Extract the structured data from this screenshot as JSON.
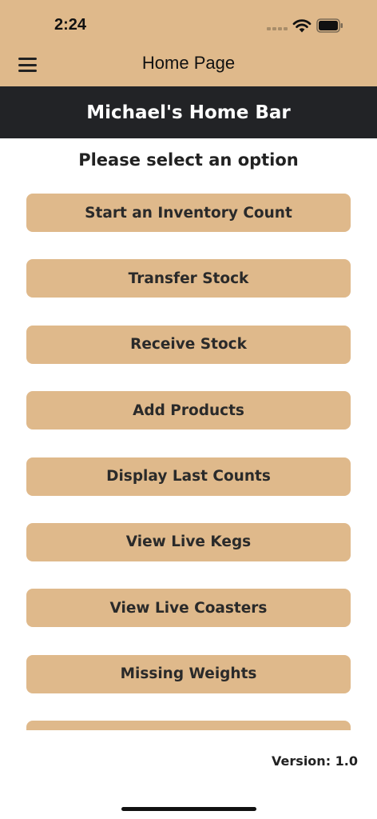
{
  "status_bar": {
    "time": "2:24",
    "icons": [
      "cellular-signal-icon",
      "wifi-icon",
      "battery-icon"
    ]
  },
  "nav": {
    "title": "Home Page",
    "menu_icon": "hamburger-menu-icon"
  },
  "banner": {
    "title": "Michael's Home Bar"
  },
  "prompt": "Please select an option",
  "options": [
    {
      "label": "Start an Inventory Count"
    },
    {
      "label": "Transfer Stock"
    },
    {
      "label": "Receive Stock"
    },
    {
      "label": "Add Products"
    },
    {
      "label": "Display Last Counts"
    },
    {
      "label": "View Live Kegs"
    },
    {
      "label": "View Live Coasters"
    },
    {
      "label": "Missing Weights"
    },
    {
      "label": ""
    }
  ],
  "footer": {
    "version": "Version: 1.0"
  },
  "colors": {
    "accent": "#dfb98b",
    "banner_bg": "#222326",
    "text": "#222222"
  }
}
